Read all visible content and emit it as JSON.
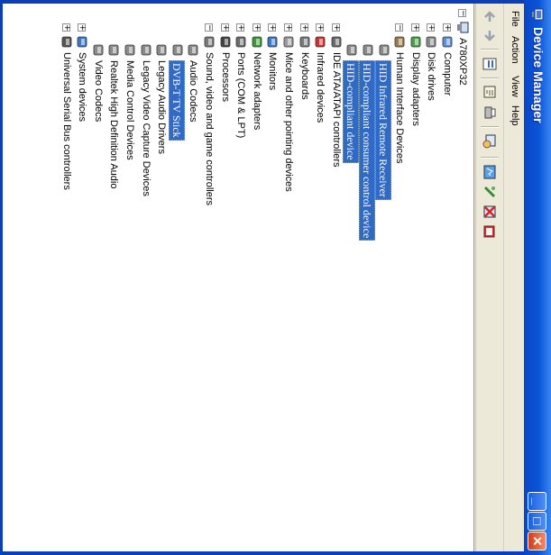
{
  "window": {
    "title": "Device Manager"
  },
  "menu": [
    "File",
    "Action",
    "View",
    "Help"
  ],
  "toolbar": [
    "back-icon",
    "forward-icon",
    "properties-icon",
    "refresh-icon",
    "print-icon",
    "scan-icon",
    "update-driver-icon",
    "uninstall-icon",
    "disable-icon",
    "cancel-icon"
  ],
  "tree": {
    "root": "A780XP32",
    "items": [
      {
        "label": "Computer",
        "expander": "+",
        "icon": "computer-icon"
      },
      {
        "label": "Disk drives",
        "expander": "+",
        "icon": "disk-drive-icon"
      },
      {
        "label": "Display adapters",
        "expander": "+",
        "icon": "display-adapter-icon"
      },
      {
        "label": "Human Interface Devices",
        "expander": "−",
        "icon": "hid-icon",
        "children": [
          {
            "label": "HID Infrared Remote Receiver",
            "selected": true,
            "icon": "hid-device-icon"
          },
          {
            "label": "HID-compliant consumer control device",
            "selected": true,
            "icon": "hid-device-icon"
          },
          {
            "label": "HID-compliant device",
            "selected": true,
            "icon": "hid-device-icon"
          }
        ]
      },
      {
        "label": "IDE ATA/ATAPI controllers",
        "expander": "+",
        "icon": "ide-icon"
      },
      {
        "label": "Infrared devices",
        "expander": "+",
        "icon": "infrared-icon"
      },
      {
        "label": "Keyboards",
        "expander": "+",
        "icon": "keyboard-icon"
      },
      {
        "label": "Mice and other pointing devices",
        "expander": "+",
        "icon": "mouse-icon"
      },
      {
        "label": "Monitors",
        "expander": "+",
        "icon": "monitor-icon"
      },
      {
        "label": "Network adapters",
        "expander": "+",
        "icon": "network-icon"
      },
      {
        "label": "Ports (COM & LPT)",
        "expander": "+",
        "icon": "port-icon"
      },
      {
        "label": "Processors",
        "expander": "+",
        "icon": "processor-icon"
      },
      {
        "label": "Sound, video and game controllers",
        "expander": "−",
        "icon": "sound-icon",
        "children": [
          {
            "label": "Audio Codecs",
            "icon": "audio-codec-icon"
          },
          {
            "label": "DVB-T TV Stick",
            "selected": true,
            "icon": "audio-codec-icon"
          },
          {
            "label": "Legacy Audio Drivers",
            "icon": "audio-codec-icon"
          },
          {
            "label": "Legacy Video Capture Devices",
            "icon": "audio-codec-icon"
          },
          {
            "label": "Media Control Devices",
            "icon": "audio-codec-icon"
          },
          {
            "label": "Realtek High Definition Audio",
            "icon": "audio-codec-icon"
          },
          {
            "label": "Video Codecs",
            "icon": "audio-codec-icon"
          }
        ]
      },
      {
        "label": "System devices",
        "expander": "+",
        "icon": "system-icon"
      },
      {
        "label": "Universal Serial Bus controllers",
        "expander": "+",
        "icon": "usb-icon"
      }
    ]
  },
  "colors": {
    "titlebar": "#0a55d8",
    "selection": "#316ac5",
    "frame": "#ece9d8"
  }
}
